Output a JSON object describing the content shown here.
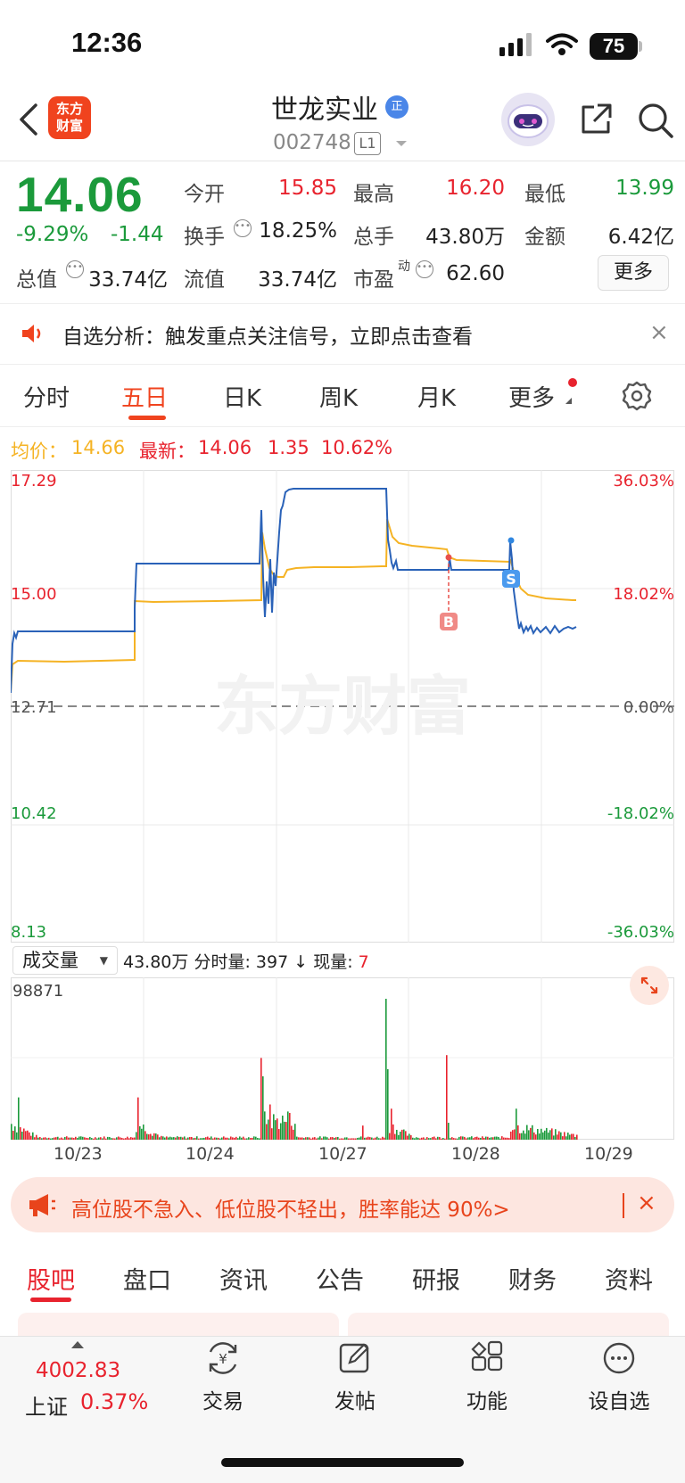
{
  "status_bar": {
    "time": "12:36",
    "battery": "75"
  },
  "header": {
    "logo_line1": "东方",
    "logo_line2": "财富",
    "stock_name": "世龙实业",
    "name_badge": "正",
    "stock_code": "002748",
    "level_badge": "L1"
  },
  "quote": {
    "price": "14.06",
    "change_pct": "-9.29%",
    "change": "-1.44",
    "items": [
      {
        "label": "今开",
        "value": "15.85"
      },
      {
        "label": "最高",
        "value": "16.20"
      },
      {
        "label": "最低",
        "value": "13.99"
      },
      {
        "label": "换手",
        "value": "18.25%"
      },
      {
        "label": "总手",
        "value": "43.80万"
      },
      {
        "label": "金额",
        "value": "6.42亿"
      },
      {
        "label": "总值",
        "value": "33.74亿"
      },
      {
        "label": "流值",
        "value": "33.74亿"
      },
      {
        "label": "市盈",
        "sup": "动",
        "value": "62.60"
      }
    ],
    "more_label": "更多"
  },
  "banner": {
    "text": "自选分析：触发重点关注信号，立即点击查看",
    "close": "×"
  },
  "period_tabs": [
    "分时",
    "五日",
    "日K",
    "周K",
    "月K",
    "更多"
  ],
  "active_period": "五日",
  "legend": {
    "avg_label": "均价：",
    "avg_value": "14.66",
    "latest_label": "最新：",
    "latest_value": "14.06",
    "latest_change": "1.35",
    "latest_pct": "10.62%"
  },
  "colors": {
    "accent": "#f0431e",
    "up": "#e8232e",
    "down": "#1b9a3b",
    "price_line": "#2a62b8",
    "avg_line": "#f5b324"
  },
  "chart_data": {
    "type": "line",
    "title": "",
    "x": [
      "10/23",
      "10/24",
      "10/27",
      "10/28",
      "10/29"
    ],
    "y_ticks": [
      "17.29",
      "15.00",
      "12.71",
      "10.42",
      "8.13"
    ],
    "y_pct_ticks": [
      "36.03%",
      "18.02%",
      "0.00%",
      "-18.02%",
      "-36.03%"
    ],
    "ylim": [
      8.13,
      17.29
    ],
    "reference_price": 12.71,
    "series": [],
    "marks": [
      {
        "label": "B",
        "day": "10/28",
        "price": 15.3
      },
      {
        "label": "S",
        "day": "10/29",
        "price": 15.8
      }
    ],
    "watermark": "东方财富"
  },
  "volume": {
    "selector": "成交量",
    "total": "43.80万",
    "minute_label": "分时量:",
    "minute_value": "397",
    "arrow": "↓",
    "now_label": "现量:",
    "now_value": "7",
    "max_tick": "98871"
  },
  "promo": {
    "text": "高位股不急入、低位股不轻出，胜率能达 90%>",
    "close": "×"
  },
  "bottom_tabs": [
    "股吧",
    "盘口",
    "资讯",
    "公告",
    "研报",
    "财务",
    "资料"
  ],
  "active_bottom_tab": "股吧",
  "nav": {
    "index_value": "4002.83",
    "index_name": "上证",
    "index_pct": "0.37%",
    "items": [
      "交易",
      "发帖",
      "功能",
      "设自选"
    ]
  }
}
